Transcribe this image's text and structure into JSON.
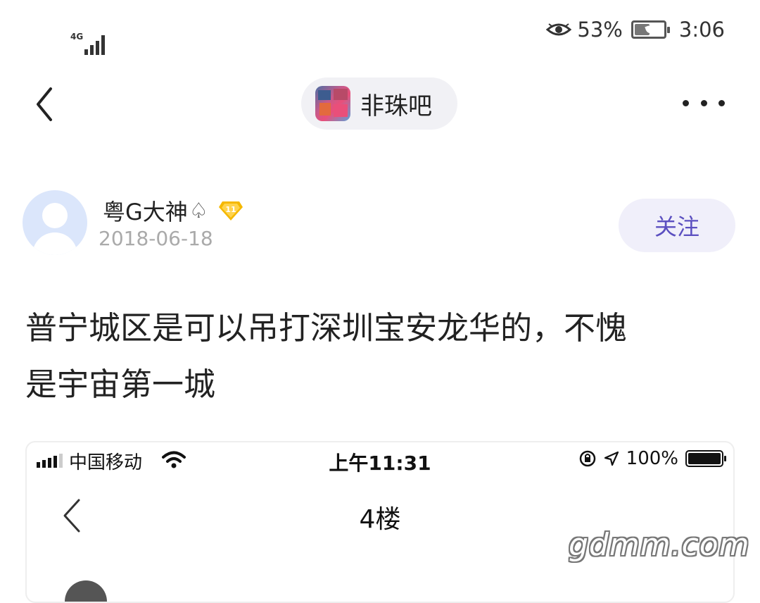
{
  "status_bar": {
    "network": "4G",
    "battery_percent": "53%",
    "battery_level": 0.53,
    "time": "3:06"
  },
  "nav": {
    "forum_name": "非珠吧",
    "icons": [
      "back-icon",
      "more-icon"
    ]
  },
  "author": {
    "name": "粤G大神",
    "suffix_symbol": "♤",
    "level": "11",
    "date": "2018-06-18",
    "follow_label": "关注"
  },
  "post": {
    "text_line1": "普宁城区是可以吊打深圳宝安龙华的，不愧",
    "text_line2": "是宇宙第一城"
  },
  "embedded_screenshot": {
    "carrier": "中国移动",
    "time": "上午11:31",
    "battery_percent": "100%",
    "battery_level": 1.0,
    "title": "4楼"
  },
  "watermark": "gdmm.com",
  "colors": {
    "accent": "#5b4fc0",
    "follow_bg": "#f0effa",
    "pill_bg": "#f1f1f5",
    "badge_gold": "#f5b800",
    "avatar_bg": "#dbe6fb"
  }
}
